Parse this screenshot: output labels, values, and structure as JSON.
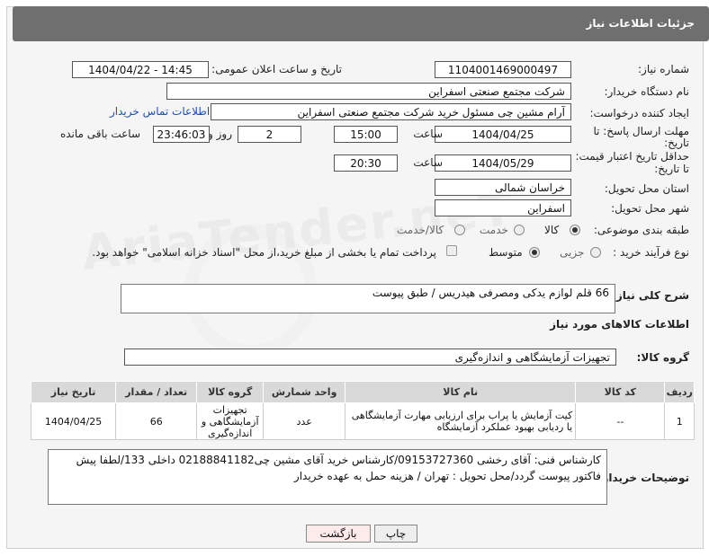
{
  "header": {
    "title": "جزئیات اطلاعات نیاز"
  },
  "form": {
    "need_number_label": "شماره نیاز:",
    "need_number": "1104001469000497",
    "announce_label": "تاریخ و ساعت اعلان عمومی:",
    "announce_value": "1404/04/22 - 14:45",
    "buyer_org_label": "نام دستگاه خریدار:",
    "buyer_org": "شرکت مجتمع صنعتی اسفراین",
    "creator_label": "ایجاد کننده درخواست:",
    "creator": "آرام مشین چی مسئول خرید شرکت مجتمع صنعتی اسفراین",
    "contact_link": "اطلاعات تماس خریدار",
    "deadline_label_1": "مهلت ارسال پاسخ: تا",
    "deadline_label_2": "تاریخ:",
    "deadline_date": "1404/04/25",
    "time_label": "ساعت",
    "deadline_time": "15:00",
    "days_value": "2",
    "days_label": "روز و",
    "remaining_value": "23:46:03",
    "remaining_label": "ساعت باقی مانده",
    "validity_label_1": "حداقل تاریخ اعتبار قیمت:",
    "validity_label_2": "تا تاریخ:",
    "validity_date": "1404/05/29",
    "validity_time": "20:30",
    "province_label": "استان محل تحویل:",
    "province": "خراسان شمالی",
    "city_label": "شهر محل تحویل:",
    "city": "اسفراین",
    "category_label": "طبقه بندی موضوعی:",
    "category_options": [
      "کالا",
      "خدمت",
      "کالا/خدمت"
    ],
    "process_label": "نوع فرآیند خرید :",
    "process_options": [
      "جزیی",
      "متوسط"
    ],
    "payment_note": "پرداخت تمام یا بخشی از مبلغ خرید،از محل \"اسناد خزانه اسلامی\" خواهد بود.",
    "summary_label": "شرح کلی نیاز:",
    "summary": "66 قلم لوازم یدکی ومصرفی هیدریس / طبق پیوست",
    "goods_info_title": "اطلاعات کالاهای مورد نیاز",
    "goods_group_label": "گروه کالا:",
    "goods_group": "تجهیزات آزمایشگاهی و اندازه‌گیری"
  },
  "table": {
    "headers": [
      "ردیف",
      "کد کالا",
      "نام کالا",
      "واحد شمارش",
      "گروه کالا",
      "تعداد / مقدار",
      "تاریخ نیاز"
    ],
    "rows": [
      {
        "row": "1",
        "code": "--",
        "name": "کیت آزمایش یا پراب برای ارزیابی مهارت آزمایشگاهی یا ردیابی بهبود عملکرد آزمایشگاه",
        "unit": "عدد",
        "group": "تجهیزات آزمایشگاهی و اندازه‌گیری",
        "qty": "66",
        "date": "1404/04/25"
      }
    ]
  },
  "notes": {
    "label": "توضیحات خریدار:",
    "text": "کارشناس فنی: آقای رخشی 09153727360/کارشناس خرید آقای مشین چی02188841182 داخلی 133/لطفا پیش فاکتور پیوست گردد/محل تحویل : تهران / هزینه حمل به عهده خریدار"
  },
  "buttons": {
    "print": "چاپ",
    "back": "بازگشت"
  },
  "watermark": "AriaTender.neT"
}
